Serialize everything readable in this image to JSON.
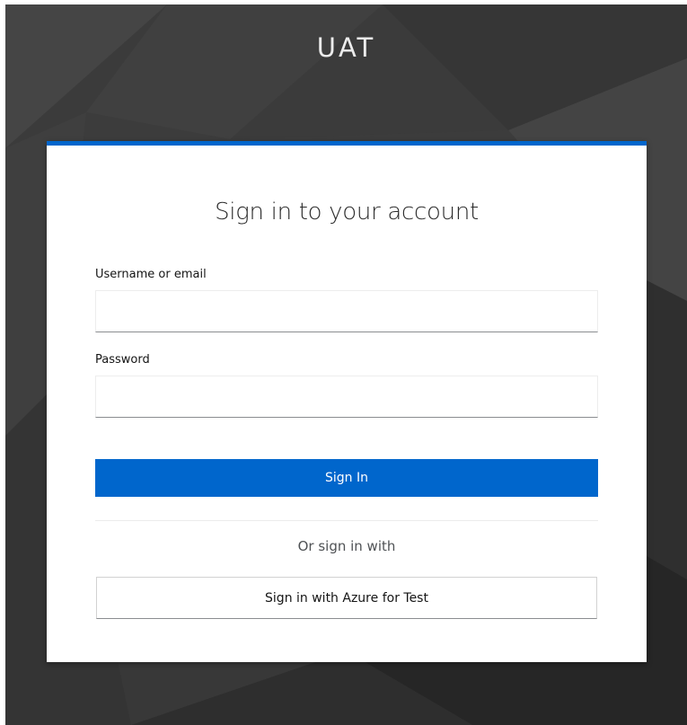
{
  "realm": {
    "title": "UAT"
  },
  "login": {
    "heading": "Sign in to your account",
    "username": {
      "label": "Username or email",
      "value": "",
      "placeholder": ""
    },
    "password": {
      "label": "Password",
      "value": "",
      "placeholder": ""
    },
    "submit_label": "Sign In",
    "social": {
      "separator_text": "Or sign in with",
      "providers": [
        {
          "label": "Sign in with Azure for Test"
        }
      ]
    }
  },
  "colors": {
    "accent": "#0066cc",
    "background": "#3a3a3a",
    "card": "#ffffff"
  }
}
